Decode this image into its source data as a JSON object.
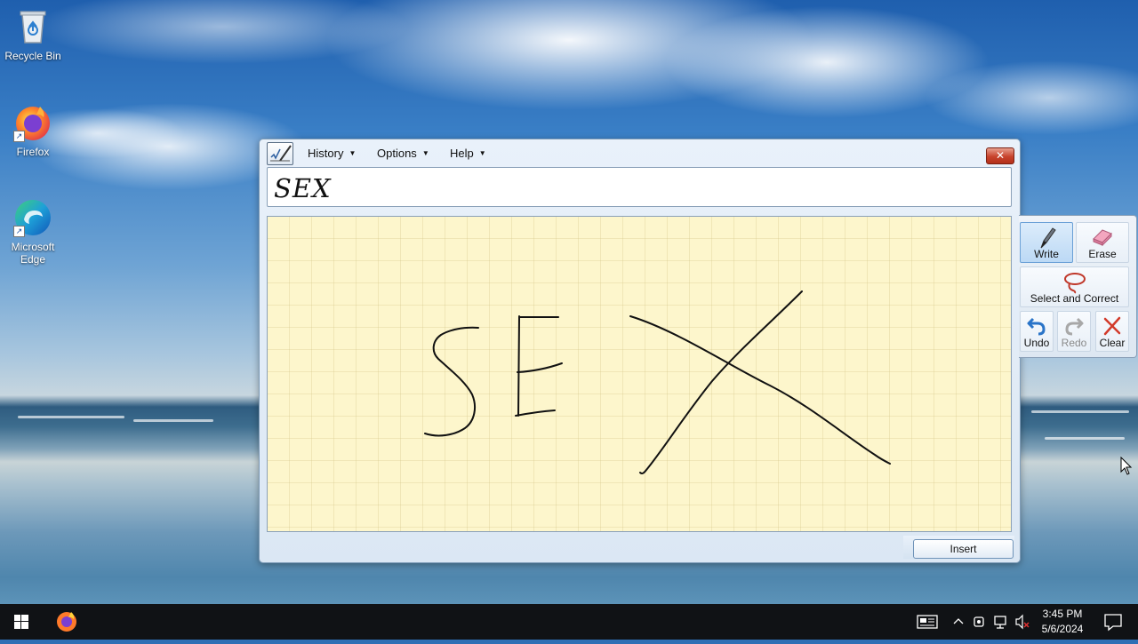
{
  "desktop": {
    "icons": [
      {
        "label": "Recycle Bin"
      },
      {
        "label": "Firefox"
      },
      {
        "label": "Microsoft Edge"
      }
    ]
  },
  "tip": {
    "menu": {
      "history": "History",
      "options": "Options",
      "help": "Help"
    },
    "close_label": "✕",
    "recognized_text": "SEX",
    "insert_label": "Insert",
    "tools": {
      "write": "Write",
      "erase": "Erase",
      "select_correct": "Select and Correct",
      "undo": "Undo",
      "redo": "Redo",
      "clear": "Clear"
    }
  },
  "taskbar": {
    "time": "3:45 PM",
    "date": "5/6/2024"
  },
  "colors": {
    "pad_background": "#fdf6cc",
    "ink": "#111111",
    "taskbar": "#101215"
  }
}
